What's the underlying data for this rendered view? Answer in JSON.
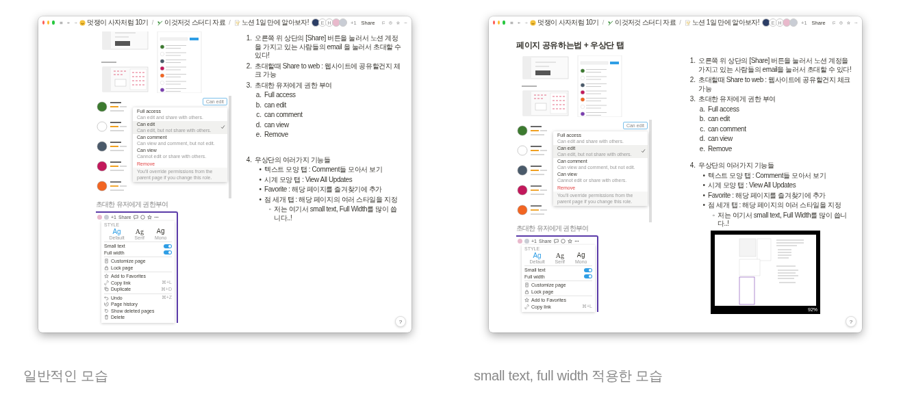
{
  "windows": [
    {
      "breadcrumbs": [
        {
          "label": "멋쟁이 사자처럼 10기"
        },
        {
          "label": "이것저것 스터디 자료"
        },
        {
          "label": "노션 1일 만에 알아보자!"
        }
      ],
      "separator": "/",
      "avatars": [
        {
          "kind": "photo"
        },
        {
          "kind": "letter",
          "text": "E"
        },
        {
          "kind": "letter",
          "text": "H"
        },
        {
          "kind": "color",
          "color": "#e9b9cc"
        },
        {
          "kind": "color",
          "color": "#c9cdd5"
        }
      ],
      "more_count": "+1",
      "share": "Share",
      "share_dialog": {
        "role_button": "Can edit",
        "options": [
          {
            "label": "Full access",
            "desc": "Can edit and share with others.",
            "selected": false
          },
          {
            "label": "Can edit",
            "desc": "Can edit, but not share with others.",
            "selected": true
          },
          {
            "label": "Can comment",
            "desc": "Can view and comment, but not edit.",
            "selected": false
          },
          {
            "label": "Can view",
            "desc": "Cannot edit or share with others.",
            "selected": false
          }
        ],
        "remove": "Remove",
        "note": "You'll override permissions from the parent page if you change this role."
      },
      "image_caption": "초대한 유저에게 권한부여",
      "style_menu": {
        "more_count": "+1",
        "share": "Share",
        "section": "STYLE",
        "fonts": [
          {
            "kind": "sans",
            "sample": "Ag",
            "label": "Default",
            "selected": true
          },
          {
            "kind": "serif",
            "sample": "Ag",
            "label": "Serif",
            "selected": false
          },
          {
            "kind": "mono",
            "sample": "Ag",
            "label": "Mono",
            "selected": false
          }
        ],
        "toggles": [
          {
            "label": "Small text",
            "on": true
          },
          {
            "label": "Full width",
            "on": true
          }
        ],
        "groups": [
          [
            {
              "label": "Customize page"
            },
            {
              "label": "Lock page"
            }
          ],
          [
            {
              "label": "Add to Favorites"
            },
            {
              "label": "Copy link",
              "shortcut": "⌘+L"
            },
            {
              "label": "Duplicate",
              "shortcut": "⌘+D"
            }
          ],
          [
            {
              "label": "Undo",
              "shortcut": "⌘+Z"
            },
            {
              "label": "Page history"
            },
            {
              "label": "Show deleted pages"
            },
            {
              "label": "Delete"
            }
          ]
        ]
      },
      "steps": [
        {
          "marker": "1.",
          "text": "오른쪽 위 상단의 [Share] 버튼을 눌러서 노션 계정을 가지고 있는 사람들의 email 을 눌러서 초대할 수 있다!"
        },
        {
          "marker": "2.",
          "text": "초대할때 Share to web : 웹사이트에 공유할건지 체크 가능"
        },
        {
          "marker": "3.",
          "text": "초대한 유저에게 권한 부여",
          "children": [
            {
              "marker": "a.",
              "text": "Full access"
            },
            {
              "marker": "b.",
              "text": "can edit"
            },
            {
              "marker": "c.",
              "text": "can comment"
            },
            {
              "marker": "d.",
              "text": "can view"
            },
            {
              "marker": "e.",
              "text": "Remove"
            }
          ]
        },
        {
          "marker": "4.",
          "text": "우상단의 여러가지 기능들",
          "children": [
            {
              "marker": "•",
              "text": "텍스트 모양 탭 : Comment들 모아서 보기"
            },
            {
              "marker": "•",
              "text": "시계 모양 탭 : View All Updates"
            },
            {
              "marker": "•",
              "text": "Favorite : 해당 페이지를 즐겨찾기에 추가"
            },
            {
              "marker": "•",
              "text": "점 세개 탭 : 해당 페이지의 여러 스타일을 지정",
              "children": [
                {
                  "marker": "◦",
                  "text": "저는 여기서 small text, Full Width를 많이 씁니다..!"
                }
              ]
            }
          ]
        }
      ],
      "help": "?"
    },
    {
      "heading": "페이지 공유하는법 + 우상단 탭",
      "breadcrumbs": [
        {
          "label": "멋쟁이 사자처럼 10기"
        },
        {
          "label": "이것저것 스터디 자료"
        },
        {
          "label": "노션 1일 만에 알아보자!"
        }
      ],
      "separator": "/",
      "avatars": [
        {
          "kind": "photo"
        },
        {
          "kind": "letter",
          "text": "E"
        },
        {
          "kind": "letter",
          "text": "H"
        },
        {
          "kind": "color",
          "color": "#e9b9cc"
        },
        {
          "kind": "color",
          "color": "#c9cdd5"
        }
      ],
      "more_count": "+1",
      "share": "Share",
      "share_dialog": {
        "role_button": "Can edit",
        "options": [
          {
            "label": "Full access",
            "desc": "Can edit and share with others.",
            "selected": false
          },
          {
            "label": "Can edit",
            "desc": "Can edit, but not share with others.",
            "selected": true
          },
          {
            "label": "Can comment",
            "desc": "Can view and comment, but not edit.",
            "selected": false
          },
          {
            "label": "Can view",
            "desc": "Cannot edit or share with others.",
            "selected": false
          }
        ],
        "remove": "Remove",
        "note": "You'll override permissions from the parent page if you change this role."
      },
      "image_caption": "초대한 유저에게 권한부여",
      "style_menu": {
        "more_count": "+1",
        "share": "Share",
        "section": "STYLE",
        "fonts": [
          {
            "kind": "sans",
            "sample": "Ag",
            "label": "Default",
            "selected": true
          },
          {
            "kind": "serif",
            "sample": "Ag",
            "label": "Serif",
            "selected": false
          },
          {
            "kind": "mono",
            "sample": "Ag",
            "label": "Mono",
            "selected": false
          }
        ],
        "toggles": [
          {
            "label": "Small text",
            "on": true
          },
          {
            "label": "Full width",
            "on": true
          }
        ],
        "groups": [
          [
            {
              "label": "Customize page"
            },
            {
              "label": "Lock page"
            }
          ],
          [
            {
              "label": "Add to Favorites"
            },
            {
              "label": "Copy link",
              "shortcut": "⌘+L"
            }
          ]
        ]
      },
      "steps": [
        {
          "marker": "1.",
          "text": "오른쪽 위 상단의 [Share] 버튼을 눌러서 노션 계정을 가지고 있는 사람들의 email을 눌러서 초대할 수 있다!"
        },
        {
          "marker": "2.",
          "text": "초대할때 Share to web : 웹사이트에 공유할건지 체크 가능"
        },
        {
          "marker": "3.",
          "text": "초대한 유저에게 권한 부여",
          "children": [
            {
              "marker": "a.",
              "text": "Full access"
            },
            {
              "marker": "b.",
              "text": "can edit"
            },
            {
              "marker": "c.",
              "text": "can comment"
            },
            {
              "marker": "d.",
              "text": "can view"
            },
            {
              "marker": "e.",
              "text": "Remove"
            }
          ]
        },
        {
          "marker": "4.",
          "text": "우상단의 여러가지 기능들",
          "children": [
            {
              "marker": "•",
              "text": "텍스트 모양 탭 : Comment들 모아서 보기"
            },
            {
              "marker": "•",
              "text": "시계 모양 탭 : View All Updates"
            },
            {
              "marker": "•",
              "text": "Favorite : 해당 페이지를 즐겨찾기에 추가"
            },
            {
              "marker": "•",
              "text": "점 세개 탭 : 해당 페이지의 여러 스타일을 지정",
              "children": [
                {
                  "marker": "◦",
                  "text": "저는 여기서 small text, Full Width를 많이 씁니다..!"
                }
              ]
            }
          ]
        }
      ],
      "preview": {
        "zoom": "92%"
      },
      "help": "?"
    }
  ],
  "captions": [
    "일반적인 모습",
    "small text, full width 적용한 모습"
  ]
}
